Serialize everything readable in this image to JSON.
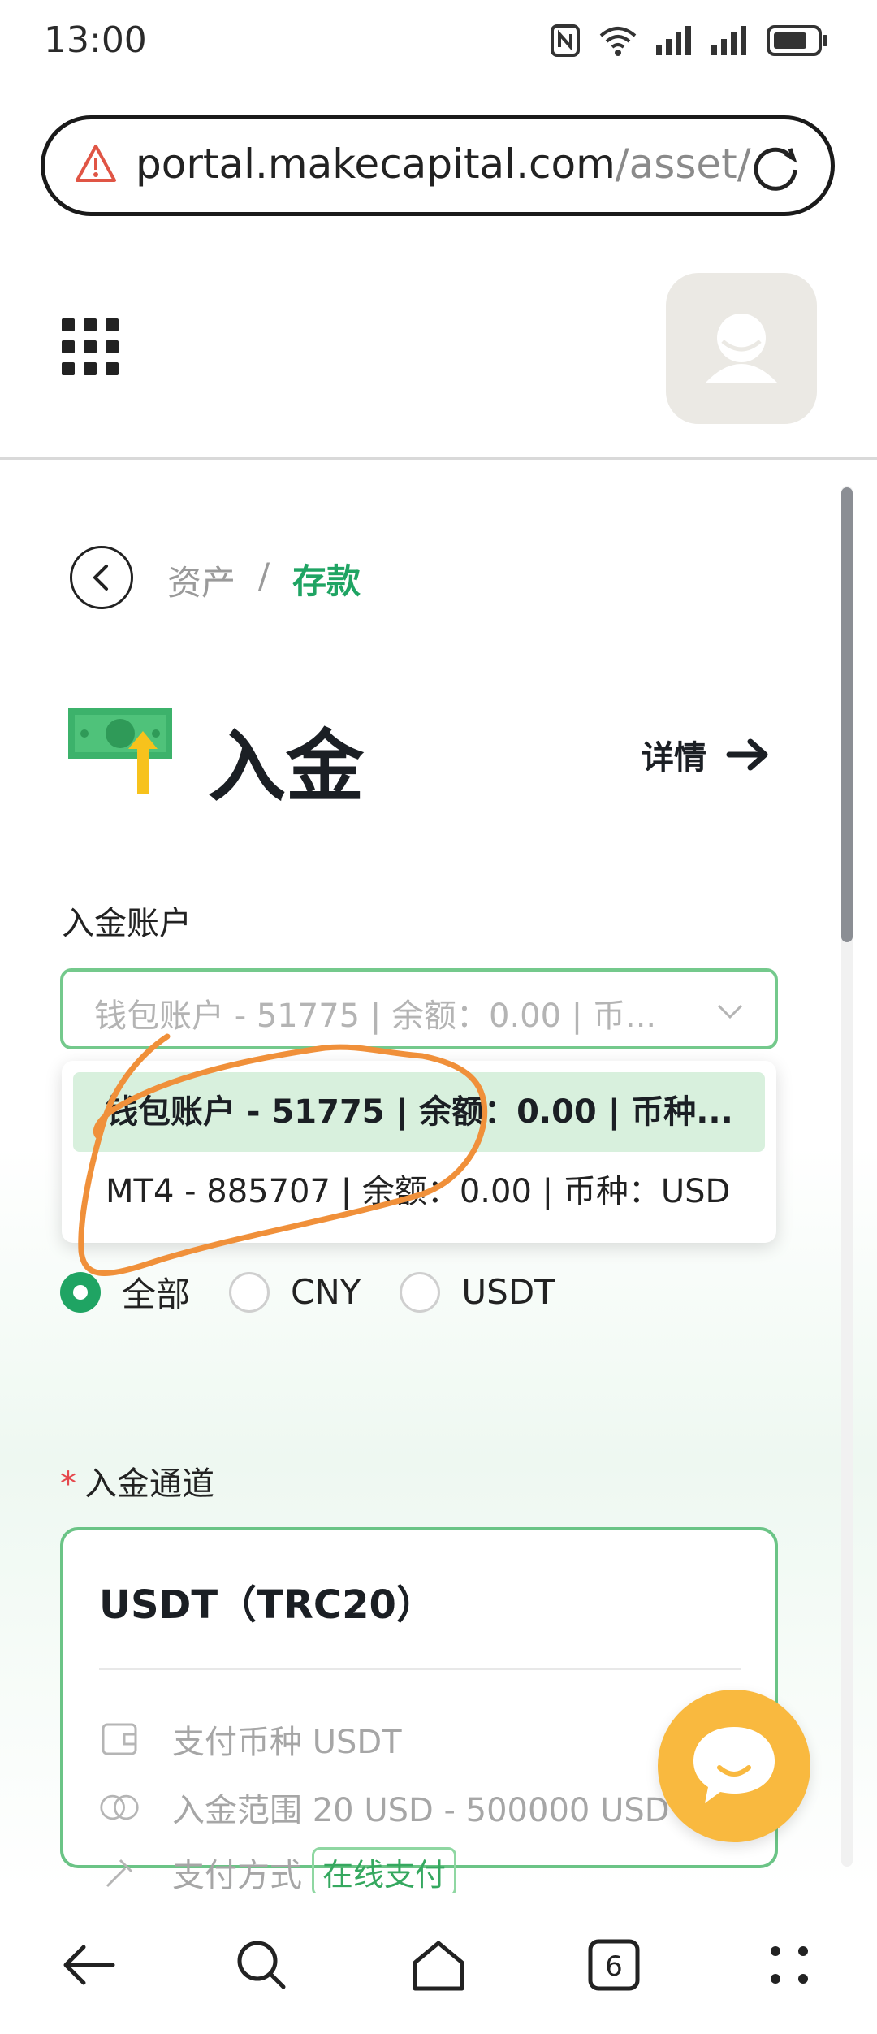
{
  "status_bar": {
    "time": "13:00"
  },
  "browser": {
    "url_main": "portal.makecapital.com",
    "url_rest": "/asset/de",
    "tab_count": "6"
  },
  "breadcrumb": {
    "parent": "资产",
    "separator": "/",
    "current": "存款"
  },
  "page": {
    "title": "入金",
    "details_label": "详情"
  },
  "account_select": {
    "label": "入金账户",
    "value": "钱包账户 - 51775 | 余额：0.00 | 币...",
    "options": [
      "钱包账户 - 51775 | 余额：0.00 | 币种...",
      "MT4 - 885707 | 余额：0.00 | 币种：USD"
    ]
  },
  "currency_filter": {
    "options": [
      "全部",
      "CNY",
      "USDT"
    ],
    "selected": "全部"
  },
  "channel": {
    "label": "入金通道",
    "required_mark": "*",
    "name": "USDT（TRC20）",
    "pay_currency": "支付币种 USDT",
    "deposit_range": "入金范围 20 USD - 500000 USD",
    "pay_method_label": "支付方式",
    "pay_method_tag": "在线支付"
  },
  "colors": {
    "accent": "#1fa463",
    "chat_fab": "#f9b93f",
    "annotation": "#f0903a"
  }
}
